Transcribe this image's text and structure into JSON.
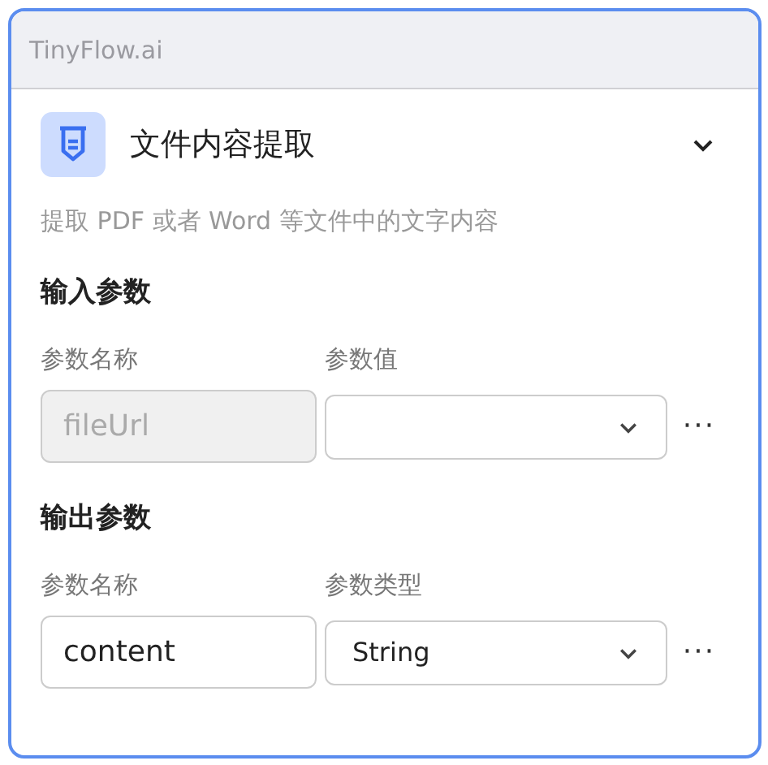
{
  "window": {
    "title": "TinyFlow.ai"
  },
  "node": {
    "title": "文件内容提取",
    "expanded": true,
    "description": "提取 PDF 或者 Word 等文件中的文字内容"
  },
  "sections": [
    {
      "heading": "输入参数",
      "columns": [
        "参数名称",
        "参数值"
      ],
      "rows": [
        {
          "name": "fileUrl",
          "disabled": true,
          "more": "···"
        }
      ]
    },
    {
      "heading": "输出参数",
      "columns": [
        "参数名称",
        "参数类型"
      ],
      "rows": [
        {
          "name": "content",
          "disabled": false,
          "value": "String",
          "more": "···"
        }
      ]
    }
  ]
}
